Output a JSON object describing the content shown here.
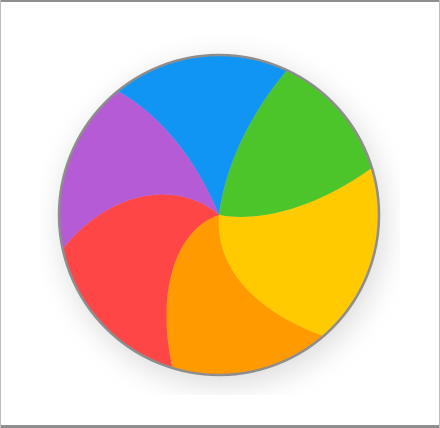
{
  "cursor": {
    "icon": "spinning-wait-cursor-icon",
    "colors": {
      "blue": "#1195f5",
      "green": "#4cc52a",
      "yellow": "#ffcb00",
      "orange": "#ff9b00",
      "red": "#ff4646",
      "purple": "#b45bd5"
    },
    "rim_color": "#8d8d8d",
    "shadow_color": "#dcdcdc"
  }
}
